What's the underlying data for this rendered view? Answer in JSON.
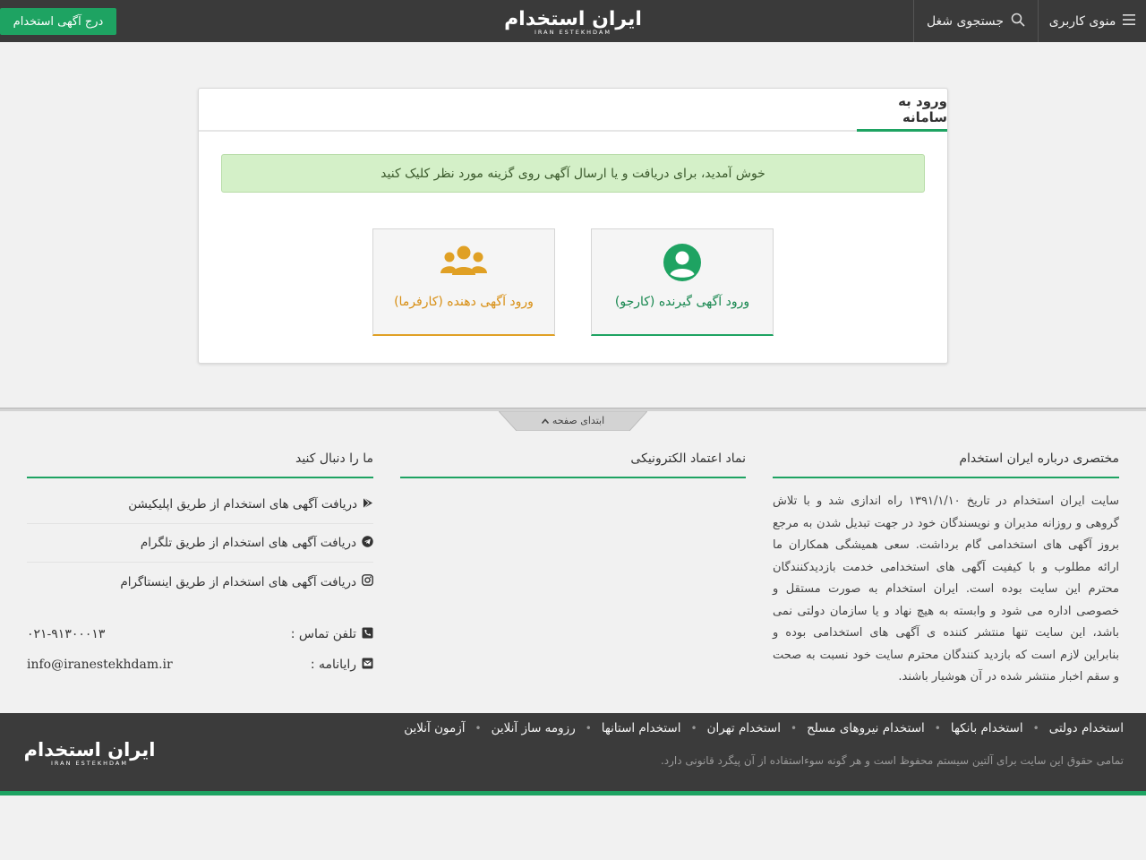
{
  "topbar": {
    "user_menu_label": "منوی کاربری",
    "job_search_label": "جستجوی شغل",
    "post_ad_label": "درج آگهی استخدام",
    "logo_text": "ایران استخدام",
    "logo_subtext": "IRAN ESTEKHDAM"
  },
  "login": {
    "title": "ورود به سامانه",
    "welcome": "خوش آمدید، برای دریافت و یا ارسال آگهی روی گزینه مورد نظر کلیک کنید",
    "seeker_label": "ورود آگهی گیرنده (کارجو)",
    "employer_label": "ورود آگهی دهنده (کارفرما)"
  },
  "back_to_top": "ابتدای صفحه",
  "footer": {
    "about_title": "مختصری درباره ایران استخدام",
    "about_text": "سایت ایران استخدام در تاریخ ۱۳۹۱/۱/۱۰ راه اندازی شد و با تلاش گروهی و روزانه مدیران و نویسندگان خود در جهت تبدیل شدن به مرجع بروز آگهی های استخدامی گام برداشت. سعی همیشگی همکاران ما ارائه مطلوب و با کیفیت آگهی های استخدامی خدمت بازدیدکنندگان محترم این سایت بوده است. ایران استخدام به صورت مستقل و خصوصی اداره می شود و وابسته به هیچ نهاد و یا سازمان دولتی نمی باشد، این سایت تنها منتشر کننده ی آگهی های استخدامی بوده و بنابراین لازم است که بازدید کنندگان محترم سایت خود نسبت به صحت و سقم اخبار منتشر شده در آن هوشیار باشند.",
    "trust_title": "نماد اعتماد الکترونیکی",
    "follow_title": "ما را دنبال کنید",
    "follow_items": [
      "دریافت آگهی های استخدام از طریق اپلیکیشن",
      "دریافت آگهی های استخدام از طریق تلگرام",
      "دریافت آگهی های استخدام از طریق اینستاگرام"
    ],
    "phone_label": "تلفن تماس :",
    "phone_value": "۰۲۱-۹۱۳۰۰۰۱۳",
    "email_label": "رایانامه :",
    "email_value": "info@iranestekhdam.ir"
  },
  "bottom": {
    "links": [
      "استخدام دولتی",
      "استخدام بانکها",
      "استخدام نیروهای مسلح",
      "استخدام تهران",
      "استخدام استانها",
      "رزومه ساز آنلاین",
      "آزمون آنلاین"
    ],
    "copyright": "تمامی حقوق این سایت برای آلتین سیستم محفوظ است و هر گونه سوءاستفاده از آن پیگرد قانونی دارد."
  },
  "colors": {
    "brand_green": "#1ea362",
    "employer_orange": "#e0a024",
    "topbar_bg": "#3a3a3a",
    "alert_bg": "#d4f0c8"
  },
  "icons": {
    "menu": "hamburger-icon",
    "search": "search-icon",
    "seeker": "user-circle-icon",
    "employer": "users-group-icon",
    "app": "google-play-icon",
    "telegram": "telegram-icon",
    "instagram": "instagram-icon",
    "phone": "phone-icon",
    "email": "envelope-icon",
    "to_top": "chevron-up-icon"
  }
}
